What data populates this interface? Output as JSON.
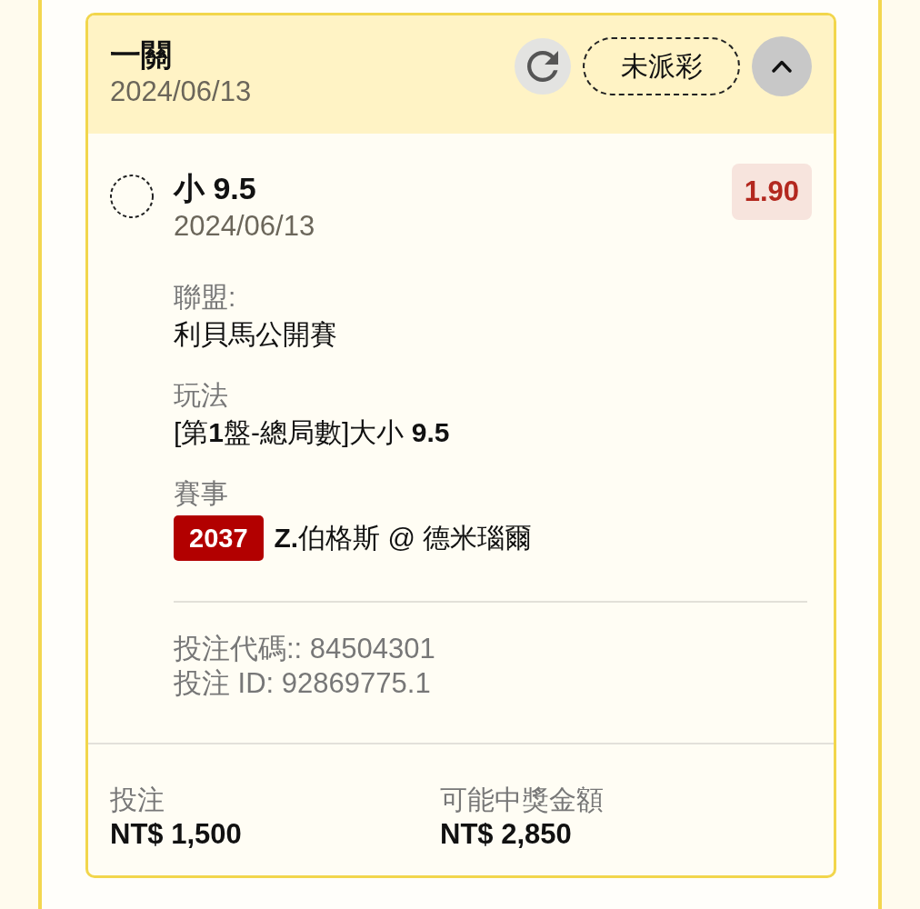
{
  "header": {
    "title": "一關",
    "date": "2024/06/13",
    "status": "未派彩",
    "expanded": true
  },
  "selection": {
    "name": "小 9.5",
    "date": "2024/06/13",
    "odds": "1.90"
  },
  "details": [
    {
      "kind": "text",
      "label": "聯盟:",
      "value": "利貝馬公開賽"
    },
    {
      "kind": "text",
      "label": "玩法",
      "value": "[第**1**盤-總局數]大小 **9.5**"
    },
    {
      "kind": "event",
      "label": "賽事",
      "event_no": "2037",
      "value": "**Z.**伯格斯 @ 德米瑙爾"
    }
  ],
  "bet_codes": [
    "投注代碼:: 84504301",
    "投注 ID: 92869775.1"
  ],
  "summary": [
    {
      "label": "投注",
      "amount": "NT$ 1,500"
    },
    {
      "label": "可能中獎金額",
      "amount": "NT$ 2,850"
    }
  ]
}
